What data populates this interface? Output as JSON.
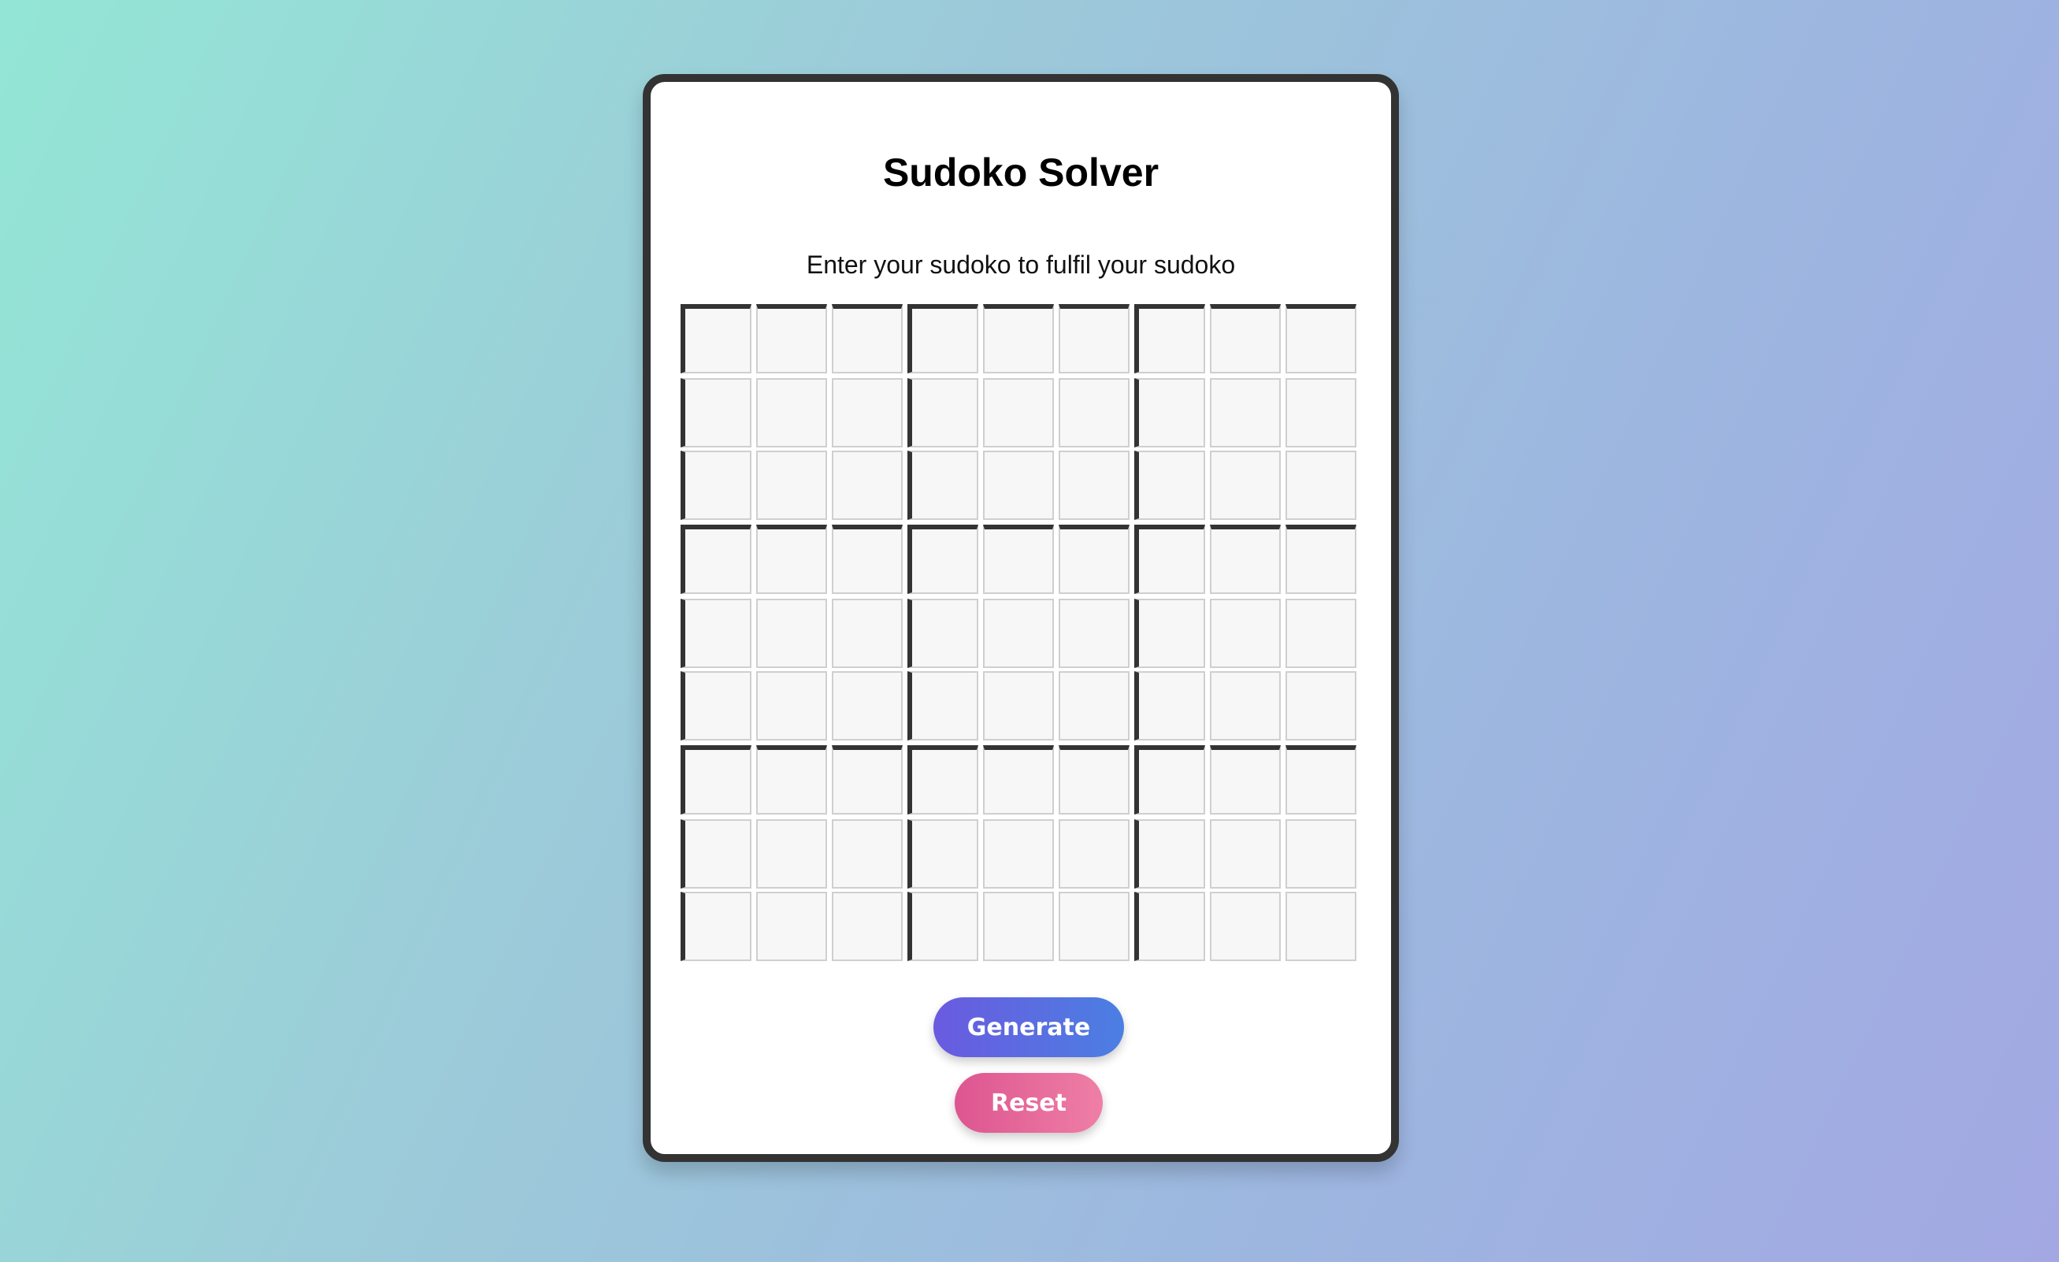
{
  "app": {
    "title": "Sudoko Solver",
    "subtitle": "Enter your sudoko to fulfil your sudoko"
  },
  "board": {
    "rows": 9,
    "cols": 9,
    "cells": [
      [
        "",
        "",
        "",
        "",
        "",
        "",
        "",
        "",
        ""
      ],
      [
        "",
        "",
        "",
        "",
        "",
        "",
        "",
        "",
        ""
      ],
      [
        "",
        "",
        "",
        "",
        "",
        "",
        "",
        "",
        ""
      ],
      [
        "",
        "",
        "",
        "",
        "",
        "",
        "",
        "",
        ""
      ],
      [
        "",
        "",
        "",
        "",
        "",
        "",
        "",
        "",
        ""
      ],
      [
        "",
        "",
        "",
        "",
        "",
        "",
        "",
        "",
        ""
      ],
      [
        "",
        "",
        "",
        "",
        "",
        "",
        "",
        "",
        ""
      ],
      [
        "",
        "",
        "",
        "",
        "",
        "",
        "",
        "",
        ""
      ],
      [
        "",
        "",
        "",
        "",
        "",
        "",
        "",
        "",
        ""
      ]
    ]
  },
  "actions": {
    "generate_label": "Generate",
    "reset_label": "Reset"
  },
  "colors": {
    "card_border": "#333333",
    "cell_background": "#f7f7f7",
    "generate_gradient_start": "#6a5ae0",
    "generate_gradient_end": "#4b7fe2",
    "reset_gradient_start": "#dd5590",
    "reset_gradient_end": "#ef7fa6"
  }
}
